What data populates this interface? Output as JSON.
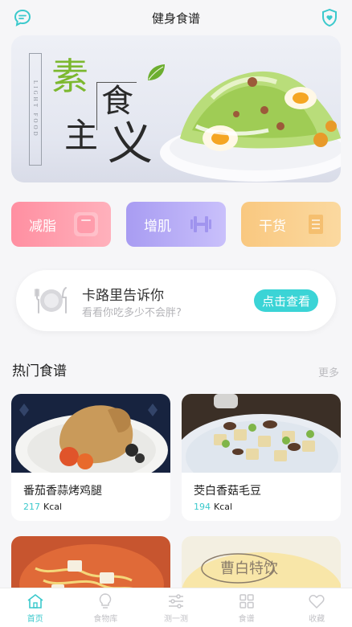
{
  "header": {
    "title": "健身食谱",
    "left_icon": "chat-icon",
    "right_icon": "shield-heart-icon",
    "accent_color": "#3bc9cc"
  },
  "banner": {
    "vertical_text": "LIGHT FOOD",
    "title_chars": [
      "素",
      "食",
      "主",
      "义"
    ]
  },
  "categories": [
    {
      "label": "减脂",
      "icon": "scale-icon",
      "color": "#ff9aa9"
    },
    {
      "label": "增肌",
      "icon": "dumbbell-icon",
      "color": "#b5aaf6"
    },
    {
      "label": "干货",
      "icon": "notebook-icon",
      "color": "#f9cf8f"
    }
  ],
  "calorie_card": {
    "title": "卡路里告诉你",
    "subtitle": "看看你吃多少不会胖?",
    "button": "点击查看",
    "icon": "plate-cutlery-icon"
  },
  "section": {
    "title": "热门食谱",
    "more": "更多"
  },
  "recipes": [
    {
      "name": "番茄香蒜烤鸡腿",
      "kcal": "217",
      "unit": "Kcal"
    },
    {
      "name": "茭白香菇毛豆",
      "kcal": "194",
      "unit": "Kcal"
    },
    {
      "name": "",
      "kcal": "",
      "unit": ""
    },
    {
      "name": "",
      "kcal": "",
      "unit": "",
      "overlay_text": "曹白特饮"
    }
  ],
  "tabs": [
    {
      "label": "首页",
      "icon": "home-icon",
      "active": true
    },
    {
      "label": "食物库",
      "icon": "bulb-icon",
      "active": false
    },
    {
      "label": "测一测",
      "icon": "sliders-icon",
      "active": false
    },
    {
      "label": "食谱",
      "icon": "grid-icon",
      "active": false
    },
    {
      "label": "收藏",
      "icon": "heart-icon",
      "active": false
    }
  ]
}
